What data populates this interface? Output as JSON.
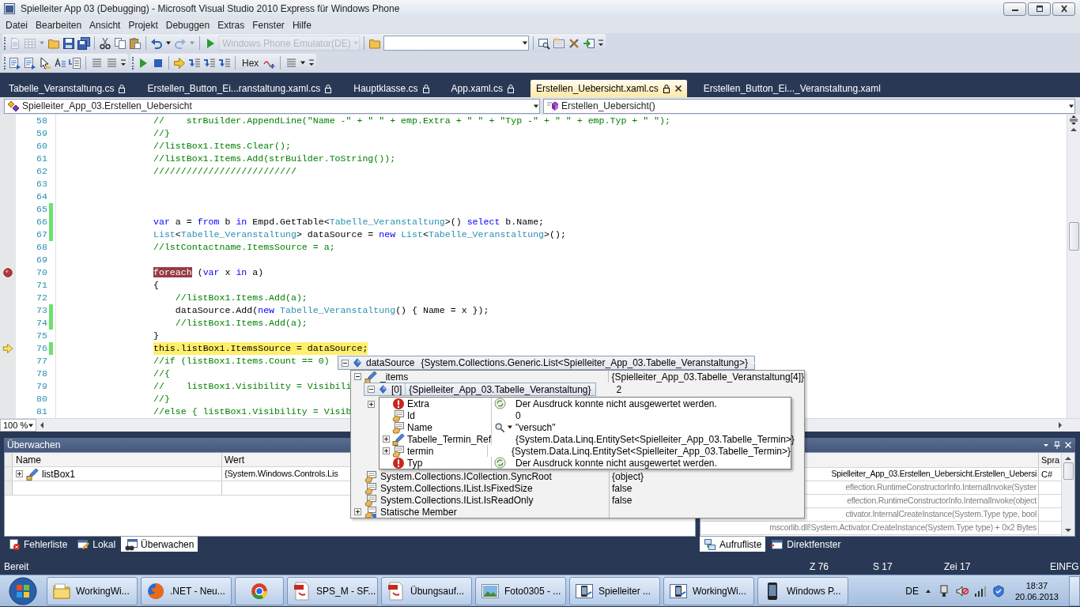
{
  "window": {
    "title": "Spielleiter App 03 (Debugging) - Microsoft Visual Studio 2010 Express für Windows Phone"
  },
  "menu": [
    "Datei",
    "Bearbeiten",
    "Ansicht",
    "Projekt",
    "Debuggen",
    "Extras",
    "Fenster",
    "Hilfe"
  ],
  "toolbar_1": [
    {
      "kind": "grip"
    },
    {
      "kind": "icon",
      "disabled": true
    },
    {
      "kind": "icon",
      "disabled": true
    },
    {
      "kind": "caret",
      "disabled": true
    },
    {
      "kind": "icon",
      "disabled": false
    },
    {
      "kind": "icon",
      "disabled": false
    },
    {
      "kind": "icon",
      "disabled": false
    },
    {
      "kind": "separator"
    },
    {
      "kind": "icon",
      "disabled": false
    },
    {
      "kind": "icon",
      "disabled": false
    },
    {
      "kind": "icon",
      "disabled": false
    },
    {
      "kind": "separator"
    },
    {
      "kind": "icon",
      "disabled": false
    },
    {
      "kind": "caret",
      "disabled": false
    },
    {
      "kind": "icon",
      "disabled": true
    },
    {
      "kind": "caret",
      "disabled": true
    },
    {
      "kind": "separator"
    },
    {
      "kind": "icon",
      "disabled": false
    },
    {
      "kind": "combo",
      "value": "Windows Phone Emulator(DE)",
      "disabled": true
    },
    {
      "kind": "separator"
    },
    {
      "kind": "icon",
      "disabled": false
    },
    {
      "kind": "combo",
      "disabled": false
    },
    {
      "kind": "separator"
    },
    {
      "kind": "icon",
      "disabled": false
    },
    {
      "kind": "icon",
      "disabled": false
    },
    {
      "kind": "icon",
      "disabled": false
    },
    {
      "kind": "icon",
      "disabled": false
    },
    {
      "kind": "overflow"
    }
  ],
  "toolbar_2": [
    {
      "kind": "grip"
    },
    {
      "kind": "icon",
      "disabled": false
    },
    {
      "kind": "icon",
      "disabled": false
    },
    {
      "kind": "icon",
      "disabled": false
    },
    {
      "kind": "icon",
      "disabled": false
    },
    {
      "kind": "icon",
      "disabled": false
    },
    {
      "kind": "separator"
    },
    {
      "kind": "icon",
      "disabled": false
    },
    {
      "kind": "icon",
      "disabled": false
    },
    {
      "kind": "overflow"
    },
    {
      "kind": "grip"
    },
    {
      "kind": "icon",
      "disabled": false
    },
    {
      "kind": "icon",
      "disabled": false
    },
    {
      "kind": "separator"
    },
    {
      "kind": "icon",
      "disabled": false
    },
    {
      "kind": "icon",
      "disabled": false
    },
    {
      "kind": "icon",
      "disabled": false
    },
    {
      "kind": "icon",
      "disabled": false
    },
    {
      "kind": "separator"
    },
    {
      "kind": "text",
      "label": "Hex"
    },
    {
      "kind": "icon",
      "disabled": false
    },
    {
      "kind": "separator"
    },
    {
      "kind": "icon",
      "disabled": false
    },
    {
      "kind": "caret",
      "disabled": false
    },
    {
      "kind": "overflow"
    }
  ],
  "tabs": [
    {
      "label": "Tabelle_Veranstaltung.cs",
      "locked": true,
      "selected": false
    },
    {
      "label": "Erstellen_Button_Ei...ranstaltung.xaml.cs",
      "locked": true,
      "selected": false
    },
    {
      "label": "Hauptklasse.cs",
      "locked": true,
      "selected": false
    },
    {
      "label": "App.xaml.cs",
      "locked": true,
      "selected": false
    },
    {
      "label": "Erstellen_Uebersicht.xaml.cs",
      "locked": true,
      "selected": true
    },
    {
      "label": "Erstellen_Button_Ei..._Veranstaltung.xaml",
      "locked": false,
      "selected": false
    }
  ],
  "type_dropdown": {
    "value": "Spielleiter_App_03.Erstellen_Uebersicht"
  },
  "member_dropdown": {
    "value": "Erstellen_Uebersicht()"
  },
  "code_lines": [
    {
      "number": "58",
      "changed": false,
      "breakpoint": false,
      "current": false,
      "segments": [
        {
          "kind": "comment",
          "text": "//    strBuilder.AppendLine(\"Name -\" + \" \" + emp.Extra + \" \" + \"Typ -\" + \" \" + emp.Typ + \" \");"
        }
      ]
    },
    {
      "number": "59",
      "changed": false,
      "breakpoint": false,
      "current": false,
      "segments": [
        {
          "kind": "comment",
          "text": "//}"
        }
      ]
    },
    {
      "number": "60",
      "changed": false,
      "breakpoint": false,
      "current": false,
      "segments": [
        {
          "kind": "comment",
          "text": "//listBox1.Items.Clear();"
        }
      ]
    },
    {
      "number": "61",
      "changed": false,
      "breakpoint": false,
      "current": false,
      "segments": [
        {
          "kind": "comment",
          "text": "//listBox1.Items.Add(strBuilder.ToString());"
        }
      ]
    },
    {
      "number": "62",
      "changed": false,
      "breakpoint": false,
      "current": false,
      "segments": [
        {
          "kind": "comment",
          "text": "//////////////////////////"
        }
      ]
    },
    {
      "number": "63",
      "changed": false,
      "breakpoint": false,
      "current": false
    },
    {
      "number": "64",
      "changed": false,
      "breakpoint": false,
      "current": false
    },
    {
      "number": "65",
      "changed": true,
      "breakpoint": false,
      "current": false
    },
    {
      "number": "66",
      "changed": true,
      "breakpoint": false,
      "current": false,
      "segments": [
        {
          "kind": "keyword",
          "text": "var"
        },
        {
          "kind": "plain",
          "text": " a = "
        },
        {
          "kind": "keyword",
          "text": "from"
        },
        {
          "kind": "plain",
          "text": " b "
        },
        {
          "kind": "keyword",
          "text": "in"
        },
        {
          "kind": "plain",
          "text": " Empd.GetTable<"
        },
        {
          "kind": "type",
          "text": "Tabelle_Veranstaltung"
        },
        {
          "kind": "plain",
          "text": ">() "
        },
        {
          "kind": "keyword",
          "text": "select"
        },
        {
          "kind": "plain",
          "text": " b.Name;"
        }
      ]
    },
    {
      "number": "67",
      "changed": true,
      "breakpoint": false,
      "current": false,
      "segments": [
        {
          "kind": "type",
          "text": "List"
        },
        {
          "kind": "plain",
          "text": "<"
        },
        {
          "kind": "type",
          "text": "Tabelle_Veranstaltung"
        },
        {
          "kind": "plain",
          "text": "> dataSource = "
        },
        {
          "kind": "keyword",
          "text": "new"
        },
        {
          "kind": "type",
          "text": " List"
        },
        {
          "kind": "plain",
          "text": "<"
        },
        {
          "kind": "type",
          "text": "Tabelle_Veranstaltung"
        },
        {
          "kind": "plain",
          "text": ">();"
        }
      ]
    },
    {
      "number": "68",
      "changed": false,
      "breakpoint": false,
      "current": false,
      "segments": [
        {
          "kind": "comment",
          "text": "//lstContactname.ItemsSource = a;"
        }
      ]
    },
    {
      "number": "69",
      "changed": false,
      "breakpoint": false,
      "current": false
    },
    {
      "number": "70",
      "changed": false,
      "breakpoint": true,
      "current": false,
      "segments": [
        {
          "kind": "breakpoint",
          "text": "foreach"
        },
        {
          "kind": "plain",
          "text": " ("
        },
        {
          "kind": "keyword",
          "text": "var"
        },
        {
          "kind": "plain",
          "text": " x "
        },
        {
          "kind": "keyword",
          "text": "in"
        },
        {
          "kind": "plain",
          "text": " a)"
        }
      ]
    },
    {
      "number": "71",
      "changed": false,
      "breakpoint": false,
      "current": false,
      "segments": [
        {
          "kind": "plain",
          "text": "{"
        }
      ]
    },
    {
      "number": "72",
      "changed": false,
      "breakpoint": false,
      "current": false,
      "segments": [
        {
          "kind": "comment",
          "text": "    //listBox1.Items.Add(a);"
        }
      ]
    },
    {
      "number": "73",
      "changed": true,
      "breakpoint": false,
      "current": false,
      "segments": [
        {
          "kind": "plain",
          "text": "    dataSource.Add("
        },
        {
          "kind": "keyword",
          "text": "new"
        },
        {
          "kind": "type",
          "text": " Tabelle_Veranstaltung"
        },
        {
          "kind": "plain",
          "text": "() { Name = x });"
        }
      ]
    },
    {
      "number": "74",
      "changed": true,
      "breakpoint": false,
      "current": false,
      "segments": [
        {
          "kind": "comment",
          "text": "    //listBox1.Items.Add(a);"
        }
      ]
    },
    {
      "number": "75",
      "changed": false,
      "breakpoint": false,
      "current": false,
      "segments": [
        {
          "kind": "plain",
          "text": "}"
        }
      ]
    },
    {
      "number": "76",
      "changed": true,
      "breakpoint": false,
      "current": true,
      "segments": [
        {
          "kind": "keyword",
          "text": "this"
        },
        {
          "kind": "plain",
          "text": ".listBox1.ItemsSource = dataSource;"
        }
      ]
    },
    {
      "number": "77",
      "changed": false,
      "breakpoint": false,
      "current": false,
      "segments": [
        {
          "kind": "comment",
          "text": "//if (listBox1.Items.Count == 0)"
        }
      ]
    },
    {
      "number": "78",
      "changed": false,
      "breakpoint": false,
      "current": false,
      "segments": [
        {
          "kind": "comment",
          "text": "//{"
        }
      ]
    },
    {
      "number": "79",
      "changed": false,
      "breakpoint": false,
      "current": false,
      "segments": [
        {
          "kind": "comment",
          "text": "//    listBox1.Visibility = Visibili"
        }
      ]
    },
    {
      "number": "80",
      "changed": false,
      "breakpoint": false,
      "current": false,
      "segments": [
        {
          "kind": "comment",
          "text": "//}"
        }
      ]
    },
    {
      "number": "81",
      "changed": false,
      "breakpoint": false,
      "current": false,
      "segments": [
        {
          "kind": "comment",
          "text": "//else { listBox1.Visibility = Visib"
        }
      ]
    }
  ],
  "zoom": {
    "value": "100 %"
  },
  "datatip": {
    "name": "dataSource",
    "value": "{System.Collections.Generic.List<Spielleiter_App_03.Tabelle_Veranstaltung>}",
    "expanded": true,
    "rows": [
      {
        "kind": "field",
        "name": "_items",
        "value": "{Spielleiter_App_03.Tabelle_Veranstaltung[4]}",
        "expanded": true
      },
      {
        "kind": "item",
        "name": "[0]",
        "value": "{Spielleiter_App_03.Tabelle_Veranstaltung}",
        "side_value": "2",
        "expanded": true,
        "children": [
          {
            "kind": "error",
            "name": "Extra",
            "value": "Der Ausdruck konnte nicht ausgewertet werden."
          },
          {
            "kind": "property",
            "name": "Id",
            "value": "0"
          },
          {
            "kind": "string",
            "name": "Name",
            "value": "\"versuch\""
          },
          {
            "kind": "field",
            "name": "Tabelle_Termin_Ref",
            "value": "{System.Data.Linq.EntitySet<Spielleiter_App_03.Tabelle_Termin>}",
            "expanded": false
          },
          {
            "kind": "property",
            "name": "termin",
            "value": "{System.Data.Linq.EntitySet<Spielleiter_App_03.Tabelle_Termin>}",
            "expanded": false
          },
          {
            "kind": "error",
            "name": "Typ",
            "value": "Der Ausdruck konnte nicht ausgewertet werden."
          }
        ]
      },
      {
        "kind": "covered",
        "expanded": false
      },
      {
        "kind": "property",
        "name": "System.Collections.ICollection.SyncRoot",
        "value": "{object}"
      },
      {
        "kind": "property",
        "name": "System.Collections.IList.IsFixedSize",
        "value": "false"
      },
      {
        "kind": "property",
        "name": "System.Collections.IList.IsReadOnly",
        "value": "false"
      },
      {
        "kind": "group",
        "name": "Statische Member",
        "expanded": false
      }
    ]
  },
  "watch_panel": {
    "title": "Überwachen",
    "columns": [
      "Name",
      "Wert"
    ],
    "rows": [
      {
        "name": "listBox1",
        "value": "{System.Windows.Controls.Lis",
        "expanded": false
      }
    ],
    "tabs": [
      {
        "label": "Fehlerliste",
        "selected": false
      },
      {
        "label": "Lokal",
        "selected": false
      },
      {
        "label": "Überwachen",
        "selected": true
      }
    ]
  },
  "call_stack_panel": {
    "columns": [
      "Spra"
    ],
    "rows": [
      {
        "name": "Spielleiter_App_03.Erstellen_Uebersicht.Erstellen_Uebersi",
        "language": "C#",
        "external": false
      },
      {
        "name": "eflection.RuntimeConstructorInfo.InternalInvoke(Syster",
        "external": true
      },
      {
        "name": "eflection.RuntimeConstructorInfo.InternalInvoke(object",
        "external": true
      },
      {
        "name": "ctivator.InternalCreateInstance(System.Type type, bool",
        "external": true
      },
      {
        "name": "mscorlib.dll!System.Activator.CreateInstance(System.Type type) + 0x2 Bytes",
        "external": true
      }
    ],
    "tabs": [
      {
        "label": "Aufrufliste",
        "selected": true
      },
      {
        "label": "Direktfenster",
        "selected": false
      }
    ]
  },
  "status_bar": {
    "message": "Bereit",
    "line": "Z 76",
    "column": "S 17",
    "char": "Zei 17",
    "mode": "EINFG"
  },
  "taskbar": {
    "buttons": [
      {
        "kind": "labeled",
        "label": "WorkingWi..."
      },
      {
        "kind": "labeled",
        "label": ".NET - Neu..."
      },
      {
        "kind": "icon"
      },
      {
        "kind": "labeled",
        "label": "SPS_M - SF..."
      },
      {
        "kind": "labeled",
        "label": "Übungsauf..."
      },
      {
        "kind": "labeled",
        "label": "Foto0305 - ..."
      },
      {
        "kind": "labeled",
        "label": "Spielleiter ..."
      },
      {
        "kind": "labeled",
        "label": "WorkingWi..."
      },
      {
        "kind": "labeled",
        "label": "Windows P..."
      }
    ],
    "language": "DE",
    "time": "18:37",
    "date": "20.06.2013"
  }
}
